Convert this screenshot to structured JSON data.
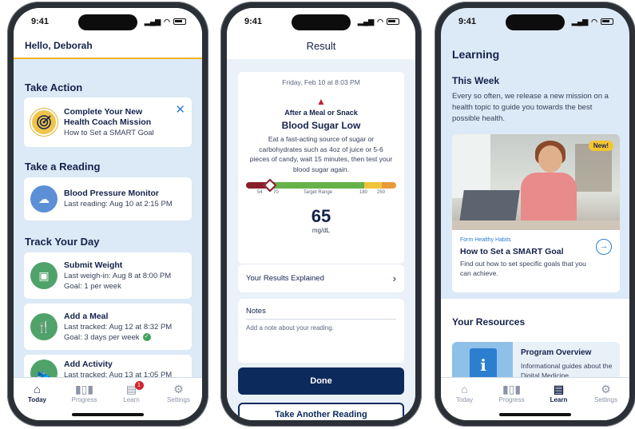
{
  "status_bar": {
    "time": "9:41"
  },
  "colors": {
    "navy": "#0d2a5c",
    "accent_yellow": "#f0b323",
    "link_blue": "#2c7fd0",
    "alert_red": "#c02030",
    "bg_blue": "#dce9f6"
  },
  "today_screen": {
    "greeting": "Hello, Deborah",
    "take_action": {
      "title": "Take Action",
      "card": {
        "title": "Complete Your New Health Coach Mission",
        "subtitle": "How to Set a SMART Goal",
        "icon": "target-icon",
        "close_icon": "close-icon"
      }
    },
    "take_reading": {
      "title": "Take a Reading",
      "card": {
        "title": "Blood Pressure Monitor",
        "subtitle": "Last reading: Aug 10 at 2:15 PM",
        "icon": "cloud-device-icon"
      }
    },
    "track_day": {
      "title": "Track Your Day",
      "items": [
        {
          "title": "Submit Weight",
          "line1": "Last weigh-in: Aug 8 at 8:00 PM",
          "line2": "Goal: 1 per week",
          "icon": "scale-icon"
        },
        {
          "title": "Add a Meal",
          "line1": "Last tracked: Aug 12 at 8:32 PM",
          "line2": "Goal: 3 days per week",
          "icon": "fork-knife-icon",
          "goal_met": true
        },
        {
          "title": "Add Activity",
          "line1": "Last tracked: Aug 13 at 1:05 PM",
          "icon": "shoe-icon"
        }
      ]
    }
  },
  "tabs": [
    {
      "label": "Today",
      "icon": "home-icon"
    },
    {
      "label": "Progress",
      "icon": "bar-chart-icon"
    },
    {
      "label": "Learn",
      "icon": "book-icon",
      "badge": "1"
    },
    {
      "label": "Settings",
      "icon": "gear-icon"
    }
  ],
  "result_screen": {
    "header": "Result",
    "date": "Friday, Feb 10 at 8:03 PM",
    "alert_icon": "warning-icon",
    "context": "After a Meal or Snack",
    "status": "Blood Sugar Low",
    "advice": "Eat a fast-acting source of sugar or carbohydrates such as 4oz of juice or 5-6 pieces of candy, wait 15 minutes, then test your blood sugar again.",
    "range_ticks": [
      "54",
      "70",
      "Target Range",
      "180",
      "250"
    ],
    "value": "65",
    "unit": "mg/dL",
    "explained_label": "Your Results Explained",
    "notes_label": "Notes",
    "notes_placeholder": "Add a note about your reading.",
    "done_label": "Done",
    "again_label": "Take Another Reading"
  },
  "learn_screen": {
    "title": "Learning",
    "this_week": "This Week",
    "intro": "Every so often, we release a new mission on a health topic to guide you towards the best possible health.",
    "feature": {
      "tag": "New!",
      "eyebrow": "Form Healthy Habits",
      "title": "How to Set a SMART Goal",
      "desc": "Find out how to set specific goals that you can achieve."
    },
    "resources_title": "Your Resources",
    "resource": {
      "title": "Program Overview",
      "desc": "Informational guides about the Digital Medicine"
    }
  }
}
